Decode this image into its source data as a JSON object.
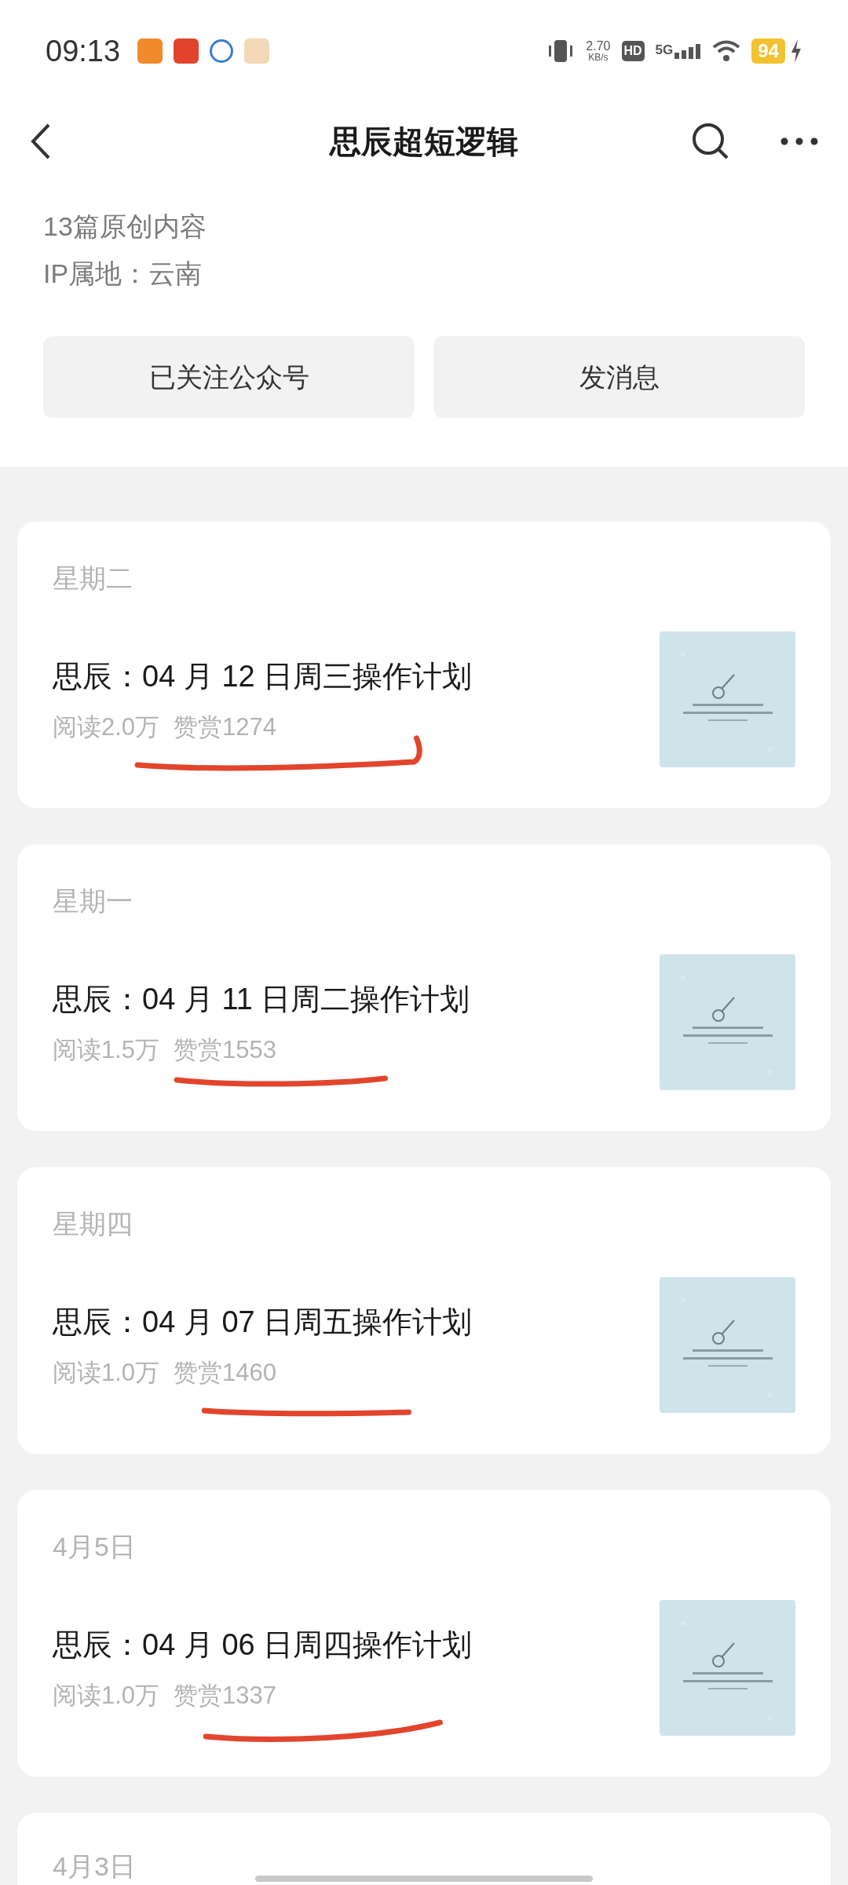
{
  "status_bar": {
    "time": "09:13",
    "speed": "2.70",
    "speed_unit": "KB/s",
    "hd": "HD",
    "network": "5G",
    "battery": "94"
  },
  "header": {
    "title": "思辰超短逻辑"
  },
  "profile": {
    "articles_count": "13篇原创内容",
    "ip_location": "IP属地：云南"
  },
  "buttons": [
    {
      "label": "已关注公众号"
    },
    {
      "label": "发消息"
    }
  ],
  "articles": [
    {
      "date": "星期二",
      "title": "思辰：04 月 12 日周三操作计划",
      "reads": "阅读2.0万",
      "rewards": "赞赏1274",
      "underlined": true
    },
    {
      "date": "星期一",
      "title": "思辰：04 月 11 日周二操作计划",
      "reads": "阅读1.5万",
      "rewards": "赞赏1553",
      "underlined": true
    },
    {
      "date": "星期四",
      "title": "思辰：04 月 07 日周五操作计划",
      "reads": "阅读1.0万",
      "rewards": "赞赏1460",
      "underlined": true
    },
    {
      "date": "4月5日",
      "title": "思辰：04 月 06 日周四操作计划",
      "reads": "阅读1.0万",
      "rewards": "赞赏1337",
      "underlined": true
    }
  ],
  "next_article": {
    "date": "4月3日"
  }
}
